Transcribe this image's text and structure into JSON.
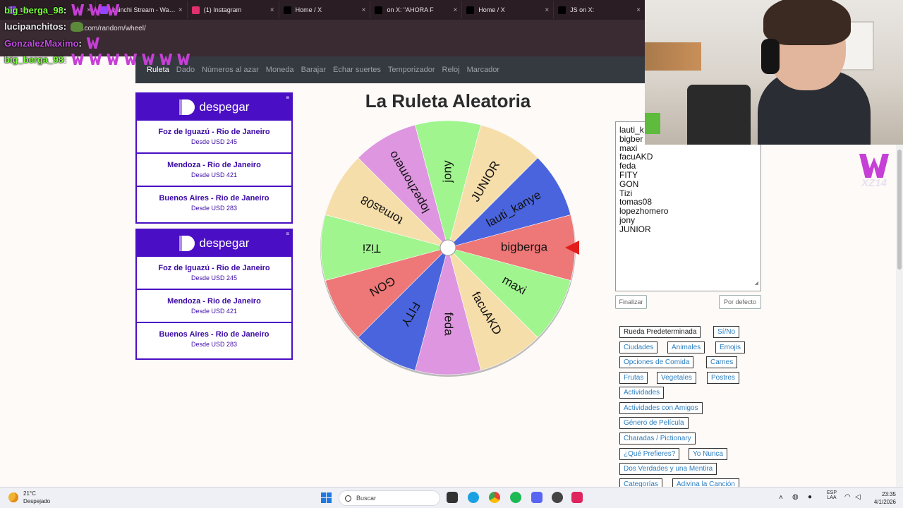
{
  "browser": {
    "tabs": [
      {
        "label": "tch"
      },
      {
        "label": "chinchi Stream - Watch"
      },
      {
        "label": "(1) Instagram"
      },
      {
        "label": "Home / X"
      },
      {
        "label": "on X: \"AHORA F"
      },
      {
        "label": "Home / X"
      },
      {
        "label": "JS on X:"
      }
    ],
    "url": "app.com/random/wheel/"
  },
  "chat": [
    {
      "user": "big_berga_98",
      "color": "#7cff3f",
      "emotes": [
        "w",
        "w",
        "w"
      ]
    },
    {
      "user": "lucipanchitos",
      "color": "#e8e8e8",
      "emotes": [
        "frog"
      ]
    },
    {
      "user": "GonzalezMaximo",
      "color": "#c04de0",
      "emotes": [
        "w"
      ]
    },
    {
      "user": "big_berga_98",
      "color": "#7cff3f",
      "emotes": [
        "w",
        "w",
        "w",
        "w",
        "w",
        "w",
        "w"
      ]
    }
  ],
  "nav": [
    "Ruleta",
    "Dado",
    "Números al azar",
    "Moneda",
    "Barajar",
    "Echar suertes",
    "Temporizador",
    "Reloj",
    "Marcador"
  ],
  "ads": [
    {
      "brand": "despegar",
      "routes": [
        {
          "title": "Foz de Iguazú - Rio de Janeiro",
          "price": "Desde USD 245"
        },
        {
          "title": "Mendoza - Rio de Janeiro",
          "price": "Desde USD 421"
        },
        {
          "title": "Buenos Aires - Rio de Janeiro",
          "price": "Desde USD 283"
        }
      ]
    },
    {
      "brand": "despegar",
      "routes": [
        {
          "title": "Foz de Iguazú - Rio de Janeiro",
          "price": "Desde USD 245"
        },
        {
          "title": "Mendoza - Rio de Janeiro",
          "price": "Desde USD 421"
        },
        {
          "title": "Buenos Aires - Rio de Janeiro",
          "price": "Desde USD 283"
        }
      ]
    }
  ],
  "wheel": {
    "title": "La Ruleta Aleatoria",
    "segments": [
      {
        "label": "bigberga",
        "color": "#ee7777"
      },
      {
        "label": "maxi",
        "color": "#a0f58e"
      },
      {
        "label": "facuAKD",
        "color": "#f6deab"
      },
      {
        "label": "feda",
        "color": "#dd96df"
      },
      {
        "label": "FITY",
        "color": "#4a64dd"
      },
      {
        "label": "GON",
        "color": "#ee7777"
      },
      {
        "label": "Tizi",
        "color": "#a0f58e"
      },
      {
        "label": "tomas08",
        "color": "#f6deab"
      },
      {
        "label": "lopezhomero",
        "color": "#dd96df"
      },
      {
        "label": "jony",
        "color": "#a0f58e"
      },
      {
        "label": "JUNIOR",
        "color": "#f6deab"
      },
      {
        "label": "lauti_kanye",
        "color": "#4a64dd"
      }
    ],
    "pointer_color": "#e31c1c"
  },
  "names_list": [
    "lauti_k",
    "bigber",
    "maxi",
    "facuAKD",
    "feda",
    "FITY",
    "GON",
    "Tizi",
    "tomas08",
    "lopezhomero",
    "jony",
    "JUNIOR"
  ],
  "buttons": {
    "finalize": "Finalizar",
    "default": "Por defecto"
  },
  "presets": [
    "Rueda Predeterminada",
    "Sí/No",
    "Ciudades",
    "Animales",
    "Emojis",
    "Opciones de Comida",
    "Carnes",
    "Frutas",
    "Vegetales",
    "Postres",
    "Actividades",
    "Actividades con Amigos",
    "Género de Película",
    "Charadas / Pictionary",
    "¿Qué Prefieres?",
    "Yo Nunca",
    "Dos Verdades y una Mentira",
    "Categorías",
    "Adivina la Canción"
  ],
  "brand_overlay": "XZ14",
  "taskbar": {
    "weather_temp": "21°C",
    "weather_cond": "Despejado",
    "search_placeholder": "Buscar",
    "lang1": "ESP",
    "lang2": "LAA",
    "time": "23:35",
    "date": "4/1/2026"
  }
}
